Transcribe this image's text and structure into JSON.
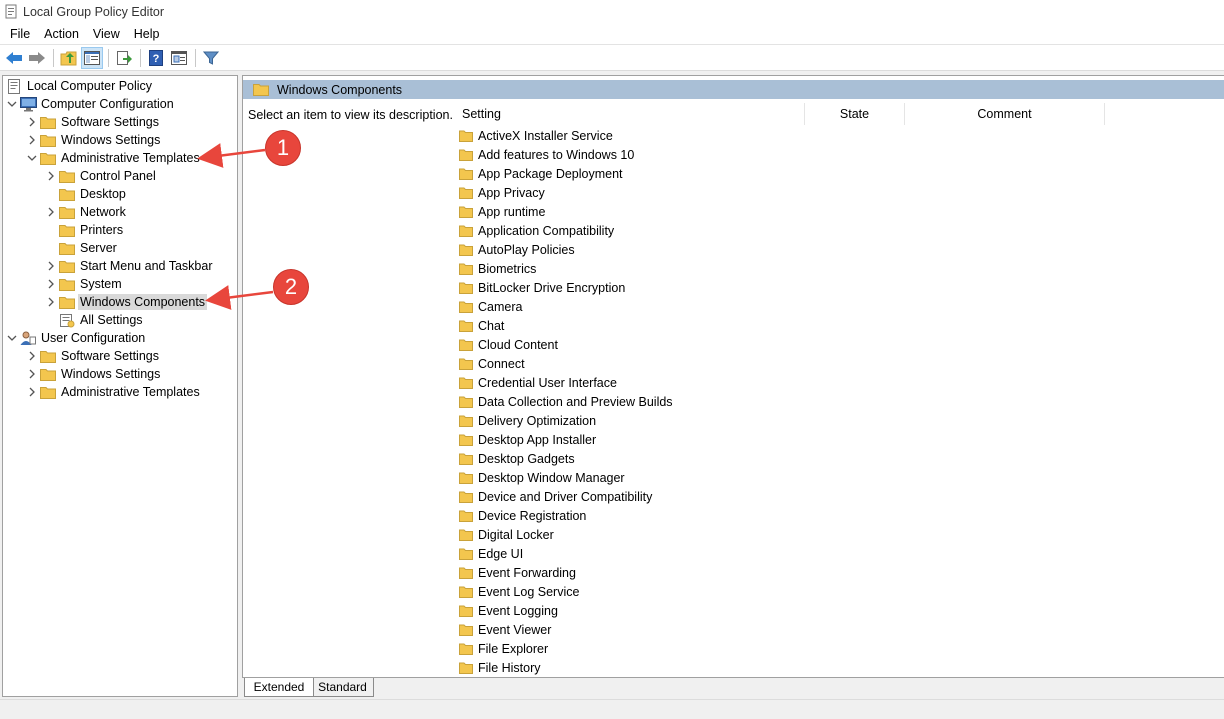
{
  "window": {
    "title": "Local Group Policy Editor"
  },
  "menu": [
    {
      "label": "File"
    },
    {
      "label": "Action"
    },
    {
      "label": "View"
    },
    {
      "label": "Help"
    }
  ],
  "toolbar": {
    "icons": [
      "back-arrow-icon",
      "forward-arrow-icon",
      "up-folder-icon",
      "show-hide-tree-icon",
      "export-list-icon",
      "help-icon",
      "properties-icon",
      "filter-icon"
    ]
  },
  "tree": [
    {
      "label": "Local Computer Policy",
      "icon": "policy-icon",
      "level": 0,
      "chevron": "none"
    },
    {
      "label": "Computer Configuration",
      "icon": "computer-icon",
      "level": 1,
      "chevron": "down"
    },
    {
      "label": "Software Settings",
      "icon": "folder-icon",
      "level": 2,
      "chevron": "right"
    },
    {
      "label": "Windows Settings",
      "icon": "folder-icon",
      "level": 2,
      "chevron": "right"
    },
    {
      "label": "Administrative Templates",
      "icon": "folder-icon",
      "level": 2,
      "chevron": "down"
    },
    {
      "label": "Control Panel",
      "icon": "folder-icon",
      "level": 3,
      "chevron": "right"
    },
    {
      "label": "Desktop",
      "icon": "folder-icon",
      "level": 3,
      "chevron": "none"
    },
    {
      "label": "Network",
      "icon": "folder-icon",
      "level": 3,
      "chevron": "right"
    },
    {
      "label": "Printers",
      "icon": "folder-icon",
      "level": 3,
      "chevron": "none"
    },
    {
      "label": "Server",
      "icon": "folder-icon",
      "level": 3,
      "chevron": "none"
    },
    {
      "label": "Start Menu and Taskbar",
      "icon": "folder-icon",
      "level": 3,
      "chevron": "right"
    },
    {
      "label": "System",
      "icon": "folder-icon",
      "level": 3,
      "chevron": "right"
    },
    {
      "label": "Windows Components",
      "icon": "folder-icon",
      "level": 3,
      "chevron": "right",
      "selected": true
    },
    {
      "label": "All Settings",
      "icon": "all-settings-icon",
      "level": 3,
      "chevron": "none"
    },
    {
      "label": "User Configuration",
      "icon": "user-icon",
      "level": 1,
      "chevron": "down"
    },
    {
      "label": "Software Settings",
      "icon": "folder-icon",
      "level": 2,
      "chevron": "right"
    },
    {
      "label": "Windows Settings",
      "icon": "folder-icon",
      "level": 2,
      "chevron": "right"
    },
    {
      "label": "Administrative Templates",
      "icon": "folder-icon",
      "level": 2,
      "chevron": "right"
    }
  ],
  "right_pane": {
    "header": "Windows Components",
    "description": "Select an item to view its description.",
    "columns": {
      "setting": "Setting",
      "state": "State",
      "comment": "Comment"
    },
    "items": [
      "ActiveX Installer Service",
      "Add features to Windows 10",
      "App Package Deployment",
      "App Privacy",
      "App runtime",
      "Application Compatibility",
      "AutoPlay Policies",
      "Biometrics",
      "BitLocker Drive Encryption",
      "Camera",
      "Chat",
      "Cloud Content",
      "Connect",
      "Credential User Interface",
      "Data Collection and Preview Builds",
      "Delivery Optimization",
      "Desktop App Installer",
      "Desktop Gadgets",
      "Desktop Window Manager",
      "Device and Driver Compatibility",
      "Device Registration",
      "Digital Locker",
      "Edge UI",
      "Event Forwarding",
      "Event Log Service",
      "Event Logging",
      "Event Viewer",
      "File Explorer",
      "File History"
    ]
  },
  "tabs": {
    "extended": "Extended",
    "standard": "Standard"
  },
  "annotations": [
    {
      "label": "1"
    },
    {
      "label": "2"
    }
  ],
  "colors": {
    "annotation": "#e8463c",
    "header_band": "#a9bfd6",
    "folder": "#f3c64e",
    "selection": "#d9d9d9"
  }
}
